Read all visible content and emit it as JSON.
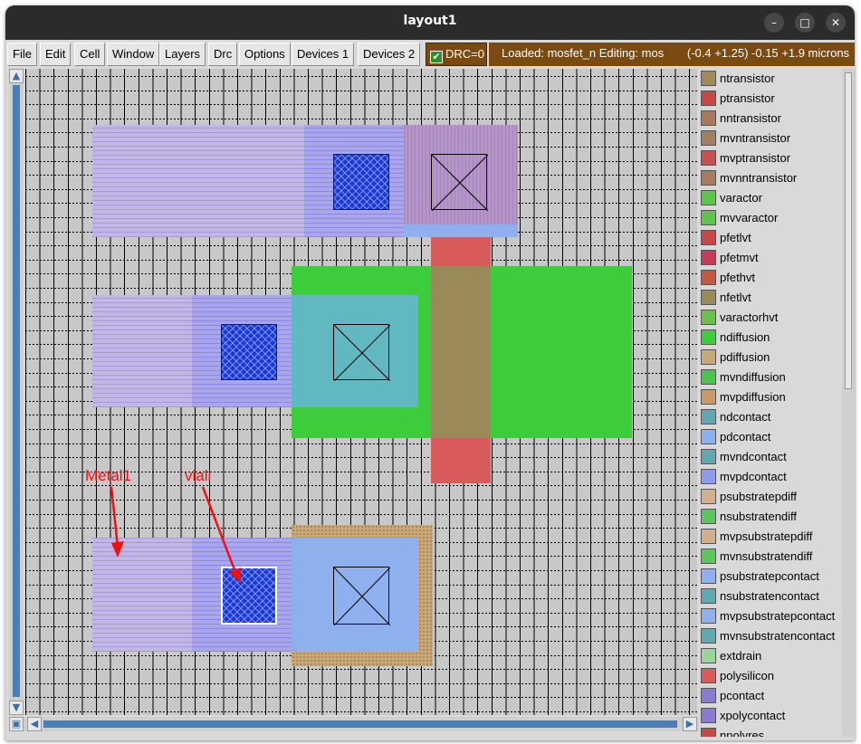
{
  "window": {
    "title": "layout1",
    "controls": [
      "–",
      "□",
      "✕"
    ]
  },
  "menu": {
    "items": [
      "File",
      "Edit",
      "Cell",
      "Window",
      "Layers",
      "Drc",
      "Options",
      "Devices 1",
      "Devices 2"
    ],
    "drc_label": "DRC=0",
    "drc_checked": true,
    "status": "Loaded: mosfet_n Editing: mos",
    "coords": "(-0.4 +1.25) -0.15 +1.9 microns"
  },
  "annotations": {
    "metal1": "Metal1",
    "viali": "viali"
  },
  "layers": [
    {
      "name": "ntransistor",
      "color": "#a08a5a"
    },
    {
      "name": "ptransistor",
      "color": "#c84848"
    },
    {
      "name": "nntransistor",
      "color": "#a87a5a"
    },
    {
      "name": "mvntransistor",
      "color": "#a08060"
    },
    {
      "name": "mvptransistor",
      "color": "#c85050"
    },
    {
      "name": "mvnntransistor",
      "color": "#a87a60"
    },
    {
      "name": "varactor",
      "color": "#5ec44a"
    },
    {
      "name": "mvvaractor",
      "color": "#5ec44a"
    },
    {
      "name": "pfetlvt",
      "color": "#c84848"
    },
    {
      "name": "pfetmvt",
      "color": "#c83a5a"
    },
    {
      "name": "pfethvt",
      "color": "#c05a40"
    },
    {
      "name": "nfetlvt",
      "color": "#9a8a5a"
    },
    {
      "name": "varactorhvt",
      "color": "#6ac04a"
    },
    {
      "name": "ndiffusion",
      "color": "#3ccc3c"
    },
    {
      "name": "pdiffusion",
      "color": "#c9a97a"
    },
    {
      "name": "mvndiffusion",
      "color": "#4ac44a"
    },
    {
      "name": "mvpdiffusion",
      "color": "#c99a6a"
    },
    {
      "name": "ndcontact",
      "color": "#62a8b0"
    },
    {
      "name": "pdcontact",
      "color": "#8fb0ef"
    },
    {
      "name": "mvndcontact",
      "color": "#62a8b0"
    },
    {
      "name": "mvpdcontact",
      "color": "#8f9aef"
    },
    {
      "name": "psubstratepdiff",
      "color": "#d4b08a"
    },
    {
      "name": "nsubstratendiff",
      "color": "#5ec45e"
    },
    {
      "name": "mvpsubstratepdiff",
      "color": "#d4b08a"
    },
    {
      "name": "mvnsubstratendiff",
      "color": "#5ec45e"
    },
    {
      "name": "psubstratepcontact",
      "color": "#8fb0ef"
    },
    {
      "name": "nsubstratencontact",
      "color": "#62a8b0"
    },
    {
      "name": "mvpsubstratepcontact",
      "color": "#8fb0ef"
    },
    {
      "name": "mvnsubstratencontact",
      "color": "#62a8b0"
    },
    {
      "name": "extdrain",
      "color": "#9ad49a"
    },
    {
      "name": "polysilicon",
      "color": "#d95a5a"
    },
    {
      "name": "pcontact",
      "color": "#8a7ad0"
    },
    {
      "name": "xpolycontact",
      "color": "#8a7ad0"
    },
    {
      "name": "npolyres",
      "color": "#c84848"
    }
  ]
}
